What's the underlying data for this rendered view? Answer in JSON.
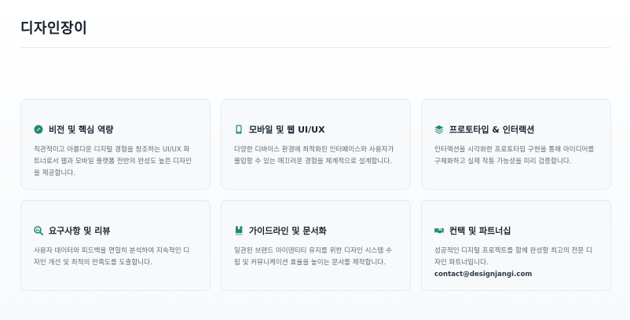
{
  "header": {
    "brand": "디자인장이"
  },
  "colors": {
    "accent": "#1f8a6e",
    "card_bg": "#f7f9fb",
    "card_border": "#e5eaee"
  },
  "cards": [
    {
      "icon": "compass-icon",
      "title": "비전 및 핵심 역량",
      "desc": "직관적이고 아름다운 디지털 경험을 창조하는 UI/UX 파트너로서 웹과 모바일 플랫폼 전반의 완성도 높은 디자인을 제공합니다."
    },
    {
      "icon": "mobile-icon",
      "title": "모바일 및 웹 UI/UX",
      "desc": "다양한 디바이스 환경에 최적화된 인터페이스와 사용자가 몰입할 수 있는 매끄러운 경험을 체계적으로 설계합니다."
    },
    {
      "icon": "layers-icon",
      "title": "프로토타입 & 인터랙션",
      "desc": "인터랙션을 시각화한 프로토타입 구현을 통해 아이디어를 구체화하고 실제 작동 가능성을 미리 검증합니다."
    },
    {
      "icon": "search-chart-icon",
      "title": "요구사항 및 리뷰",
      "desc": "사용자 데이터와 피드백을 면밀히 분석하여 지속적인 디자인 개선 및 최적의 만족도를 도출합니다."
    },
    {
      "icon": "book-icon",
      "title": "가이드라인 및 문서화",
      "desc": "일관된 브랜드 아이덴티티 유지를 위한 디자인 시스템 수립 및 커뮤니케이션 효율을 높이는 문서를 제작합니다."
    },
    {
      "icon": "handshake-icon",
      "title": "컨택 및 파트너십",
      "desc": "성공적인 디지털 프로젝트를 함께 완성할 최고의 전문 디자인 파트너입니다.",
      "contact": "contact@designjangi.com"
    }
  ]
}
